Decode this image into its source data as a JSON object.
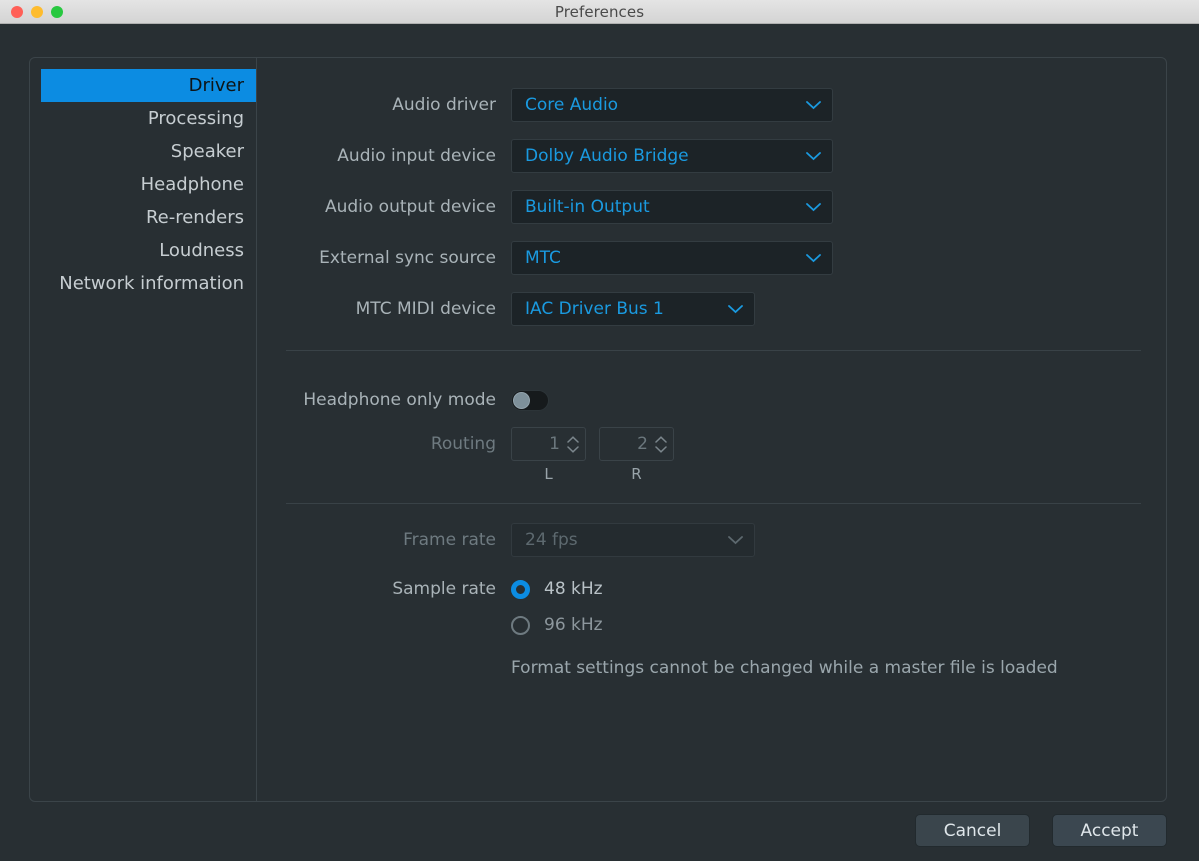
{
  "window": {
    "title": "Preferences",
    "traffic_lights": [
      "close-red",
      "minimize-yellow",
      "zoom-green"
    ]
  },
  "sidebar": {
    "items": [
      {
        "label": "Driver",
        "active": true
      },
      {
        "label": "Processing",
        "active": false
      },
      {
        "label": "Speaker",
        "active": false
      },
      {
        "label": "Headphone",
        "active": false
      },
      {
        "label": "Re-renders",
        "active": false
      },
      {
        "label": "Loudness",
        "active": false
      },
      {
        "label": "Network information",
        "active": false
      }
    ]
  },
  "driver": {
    "audio_driver": {
      "label": "Audio driver",
      "value": "Core Audio"
    },
    "audio_input_device": {
      "label": "Audio input device",
      "value": "Dolby Audio Bridge"
    },
    "audio_output_device": {
      "label": "Audio output device",
      "value": "Built-in Output"
    },
    "external_sync_source": {
      "label": "External sync source",
      "value": "MTC"
    },
    "mtc_midi_device": {
      "label": "MTC MIDI device",
      "value": "IAC Driver Bus 1"
    },
    "headphone_only_mode": {
      "label": "Headphone only mode",
      "state": "off"
    },
    "routing": {
      "label": "Routing",
      "left": {
        "value": "1",
        "caption": "L"
      },
      "right": {
        "value": "2",
        "caption": "R"
      }
    },
    "frame_rate": {
      "label": "Frame rate",
      "value": "24 fps",
      "disabled": true
    },
    "sample_rate": {
      "label": "Sample rate",
      "options": [
        {
          "label": "48 kHz",
          "selected": true
        },
        {
          "label": "96 kHz",
          "selected": false
        }
      ]
    },
    "format_note": "Format settings cannot be changed while a master file is loaded"
  },
  "footer": {
    "cancel_label": "Cancel",
    "accept_label": "Accept"
  },
  "colors": {
    "accent": "#0c8ce2",
    "link_text": "#1a9ae0",
    "panel_bg": "#282f33",
    "field_bg": "#1c2327",
    "label_text": "#a9b3b8"
  }
}
